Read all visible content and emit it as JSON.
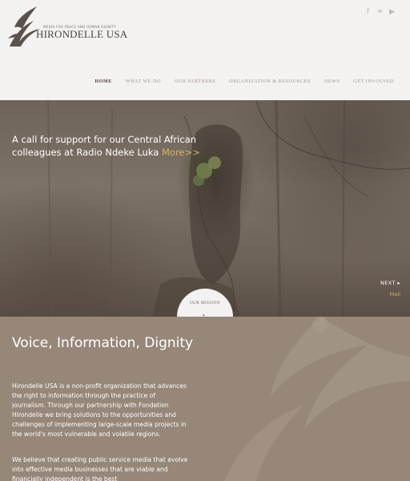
{
  "header": {
    "logo": {
      "tagline": "MEDIA FOR PEACE AND HUMAN DIGNITY",
      "name": "HIRONDELLE USA"
    },
    "social": [
      {
        "icon": "facebook-icon",
        "glyph": "f"
      },
      {
        "icon": "twitter-icon",
        "glyph": "❧"
      },
      {
        "icon": "youtube-icon",
        "glyph": "▶"
      }
    ],
    "nav": [
      {
        "label": "HOME",
        "active": true
      },
      {
        "label": "WHAT WE DO",
        "active": false
      },
      {
        "label": "OUR PARTNERS",
        "active": false
      },
      {
        "label": "ORGANIZATION & RESOURCES",
        "active": false
      },
      {
        "label": "NEWS",
        "active": false
      },
      {
        "label": "GET INVOLVED",
        "active": false
      }
    ]
  },
  "hero": {
    "title": "A call for support for our Central African colleagues at Radio Ndeke Luka ",
    "more": "More>>",
    "next_label": "NEXT ▸",
    "next_sub": "Mali",
    "mission_tab": "OUR MISSION",
    "mission_arrow": "▾"
  },
  "mission": {
    "title": "Voice, Information, Dignity",
    "paragraph1": "Hirondelle USA is a non-profit organization that advances the right to information through the practice of journalism. Through our partnership with Fondation Hirondelle we bring solutions to the opportunities and challenges of implementing large-scale media projects in the world's most vulnerable and volatile regions.",
    "paragraph2": "We believe that creating public service media that evolve into effective media businesses that are viable and financially independent is the best"
  },
  "colors": {
    "header_bg": "#f4f1f1",
    "mission_bg": "#968779",
    "accent_gold": "#d6b35c",
    "nav_active": "#4c4340"
  }
}
